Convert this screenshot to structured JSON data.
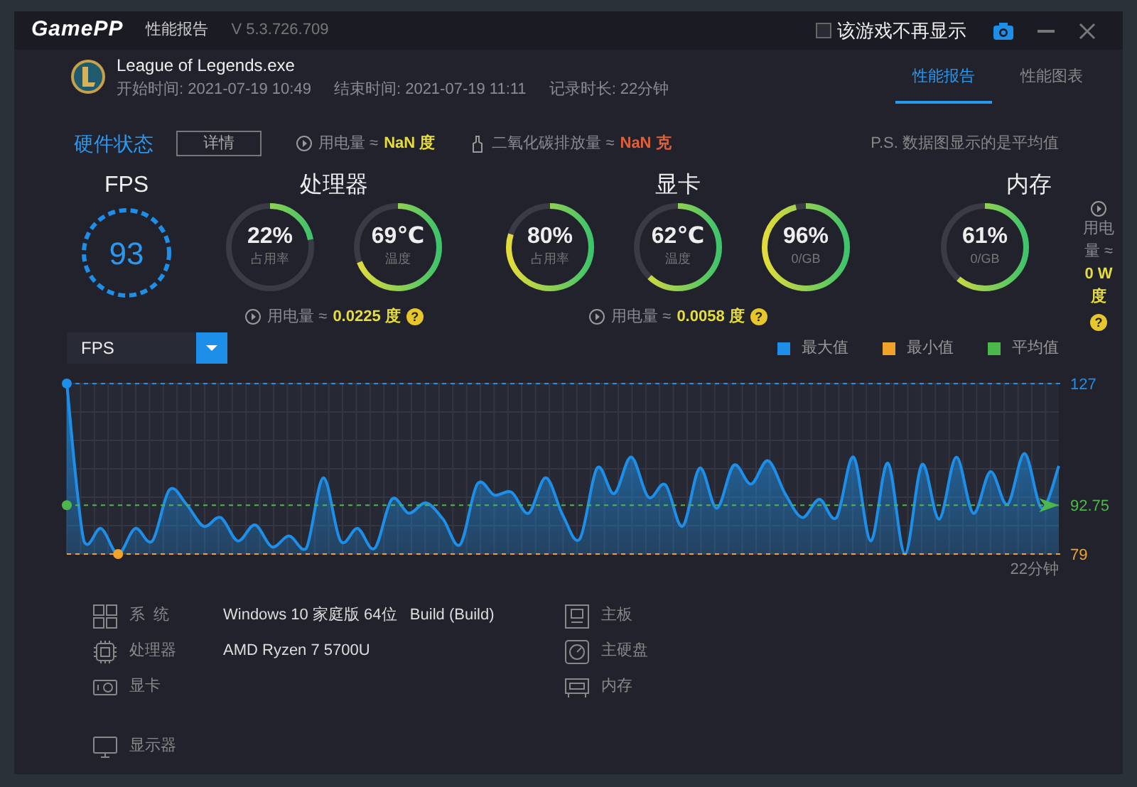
{
  "window": {
    "logo": "GamePP",
    "title": "性能报告",
    "version": "V 5.3.726.709",
    "hide_option": {
      "label": "该游戏不再显示",
      "checked": false
    }
  },
  "game": {
    "name": "League of Legends.exe",
    "start": "开始时间: 2021-07-19 10:49",
    "end": "结束时间: 2021-07-19 11:11",
    "duration": "记录时长: 22分钟"
  },
  "tabs": [
    {
      "label": "性能报告",
      "selected": true
    },
    {
      "label": "性能图表",
      "selected": false
    }
  ],
  "status": {
    "title": "硬件状态",
    "details_button": "详情",
    "power_label": "用电量 ≈",
    "power_value": "NaN 度",
    "co2_label": "二氧化碳排放量 ≈",
    "co2_value": "NaN 克",
    "note": "P.S. 数据图显示的是平均值"
  },
  "fps": {
    "title": "FPS",
    "value": "93"
  },
  "groups": [
    {
      "title": "处理器",
      "kind": "below",
      "power_label": "用电量 ≈",
      "power_value": "0.0225 度",
      "help": "?",
      "gauges": [
        {
          "value": "22%",
          "label": "占用率",
          "level": 0.22
        },
        {
          "value": "69℃",
          "label": "温度",
          "level": 0.69
        }
      ]
    },
    {
      "title": "显卡",
      "kind": "below",
      "power_label": "用电量 ≈",
      "power_value": "0.0058 度",
      "help": "?",
      "gauges": [
        {
          "value": "80%",
          "label": "占用率",
          "level": 0.8
        },
        {
          "value": "62℃",
          "label": "温度",
          "level": 0.62
        },
        {
          "value": "96%",
          "label": "0/GB",
          "level": 0.96
        }
      ]
    },
    {
      "title": "内存",
      "kind": "side",
      "power_label": "用电量 ≈",
      "power_value": "0 W 度",
      "help": "?",
      "gauges": [
        {
          "value": "61%",
          "label": "0/GB",
          "level": 0.61
        }
      ]
    }
  ],
  "chart": {
    "legend": [
      {
        "label": "最大值",
        "color": "#1e8fe8"
      },
      {
        "label": "最小值",
        "color": "#f0a22a"
      }
    ],
    "duration_label": "22分钟",
    "chart_data": {
      "type": "area",
      "ylim": [
        79,
        127
      ],
      "yticks": [
        127,
        92.75,
        79
      ],
      "grid": true,
      "series": [
        {
          "name": "FPS",
          "color": "#1e8fe8",
          "values": [
            127,
            82.7,
            86.2,
            79,
            86.2,
            82.7,
            97.1,
            93.0,
            86.8,
            89.3,
            82.7,
            87.2,
            81.0,
            84.1,
            80.6,
            100.5,
            82.7,
            86.2,
            80.6,
            94.4,
            90.5,
            93.4,
            88.8,
            81.7,
            98.7,
            95.6,
            96.4,
            90.5,
            100.5,
            89.9,
            83.3,
            103.2,
            96.0,
            106.3,
            95.0,
            98.5,
            86.8,
            103.2,
            91.9,
            104.0,
            98.7,
            105.3,
            96.0,
            89.3,
            94.4,
            89.3,
            106.3,
            82.7,
            104.6,
            79,
            104.2,
            88.8,
            106.3,
            90.5,
            102.2,
            93.0,
            107.3,
            91.9,
            103.8
          ]
        },
        {
          "name": "平均值",
          "type": "line",
          "line_style": "dashed",
          "color": "#4cb84c",
          "values": [
            92.75,
            92.75,
            92.75,
            92.75,
            92.75,
            92.75,
            92.75,
            92.75,
            92.75,
            92.75,
            92.75,
            92.75,
            92.75,
            92.75,
            92.75,
            92.75,
            92.75,
            92.75,
            92.75,
            92.75,
            92.75,
            92.75,
            92.75,
            92.75,
            92.75,
            92.75,
            92.75,
            92.75,
            92.75,
            92.75,
            92.75,
            92.75,
            92.75,
            92.75,
            92.75,
            92.75,
            92.75,
            92.75,
            92.75,
            92.75,
            92.75,
            92.75,
            92.75,
            92.75,
            92.75,
            92.75,
            92.75,
            92.75,
            92.75,
            92.75,
            92.75,
            92.75,
            92.75,
            92.75,
            92.75,
            92.75,
            92.75,
            92.75,
            92.75
          ]
        }
      ]
    }
  },
  "system_info": [
    {
      "kind": "system",
      "label": "系  统",
      "value": "Windows 10 家庭版 64位   Build (Build)"
    },
    {
      "kind": "board",
      "label": "主板"
    },
    {
      "kind": "cpu",
      "label": "处理器",
      "value": "AMD Ryzen 7 5700U"
    },
    {
      "kind": "disk",
      "label": "主硬盘"
    },
    {
      "kind": "gpu",
      "label": "显卡"
    },
    {
      "kind": "ram",
      "label": "内存"
    },
    {
      "kind": "monitor",
      "label": "显示器"
    }
  ]
}
